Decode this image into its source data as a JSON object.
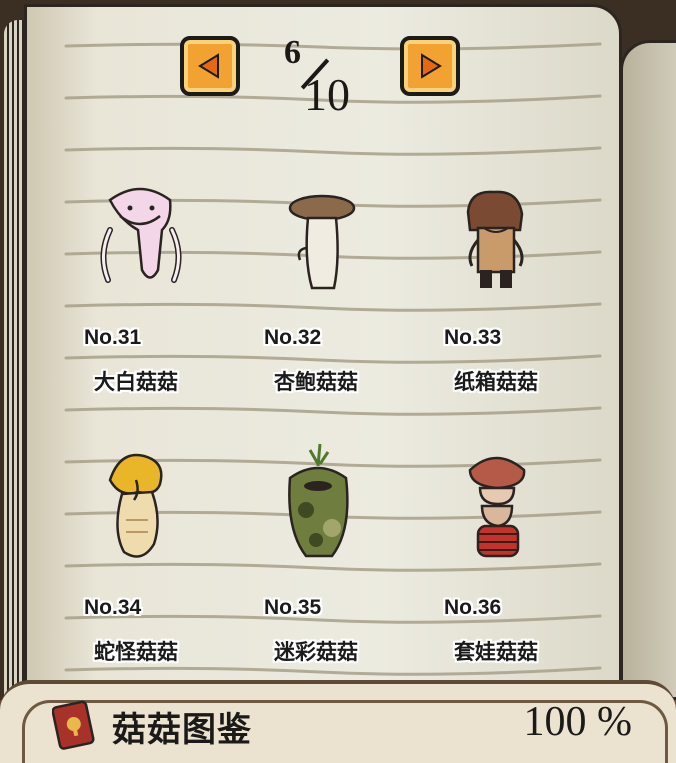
{
  "pager": {
    "current": "6",
    "total": "10"
  },
  "entries": [
    {
      "number": "No.31",
      "name": "大白菇菇"
    },
    {
      "number": "No.32",
      "name": "杏鲍菇菇"
    },
    {
      "number": "No.33",
      "name": "纸箱菇菇"
    },
    {
      "number": "No.34",
      "name": "蛇怪菇菇"
    },
    {
      "number": "No.35",
      "name": "迷彩菇菇"
    },
    {
      "number": "No.36",
      "name": "套娃菇菇"
    }
  ],
  "footer": {
    "title": "菇菇图鉴",
    "completion": "100 %"
  },
  "colors": {
    "button": "#f2a230",
    "page": "#ecebe0",
    "ink": "#1b1816"
  }
}
